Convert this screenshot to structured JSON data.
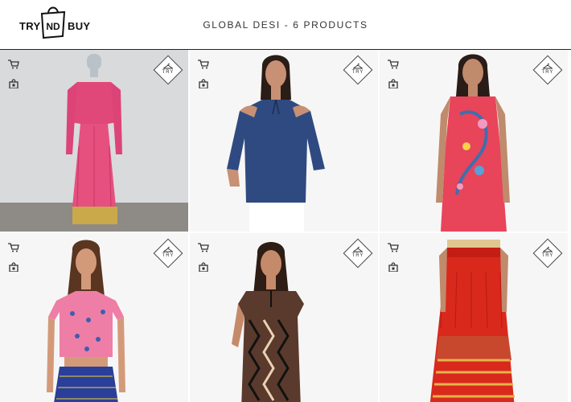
{
  "brand": {
    "left": "TRY",
    "right": "BUY",
    "mark": "ND"
  },
  "header": {
    "title": "GLOBAL DESI - 6 PRODUCTS"
  },
  "badge_label": "TRY",
  "icons": {
    "cart": "cart-icon",
    "shop": "shopping-bag-icon",
    "try": "hanger-icon"
  },
  "products": [
    {
      "kind": "pink-anarkali-dress"
    },
    {
      "kind": "navy-cold-shoulder-top"
    },
    {
      "kind": "red-embroidered-shift-dress"
    },
    {
      "kind": "pink-crop-top-blue-skirt"
    },
    {
      "kind": "black-ikat-kurta"
    },
    {
      "kind": "red-printed-maxi-skirt"
    }
  ]
}
